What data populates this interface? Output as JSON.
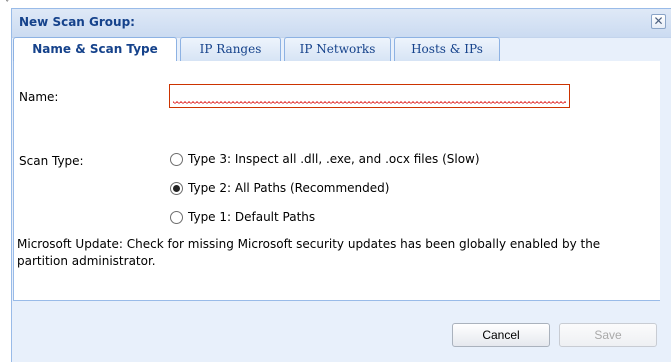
{
  "dialog": {
    "title": "New Scan Group:",
    "close_symbol": "✕",
    "caret_symbol": "ˇ"
  },
  "tabs": [
    {
      "label": "Name & Scan Type",
      "active": true
    },
    {
      "label": "IP Ranges",
      "active": false
    },
    {
      "label": "IP Networks",
      "active": false
    },
    {
      "label": "Hosts & IPs",
      "active": false
    }
  ],
  "form": {
    "name_label": "Name:",
    "name_value": "",
    "name_invalid": true,
    "scan_type_label": "Scan Type:",
    "scan_types": [
      {
        "label": "Type 3: Inspect all .dll, .exe, and .ocx files (Slow)",
        "checked": false
      },
      {
        "label": "Type 2: All Paths (Recommended)",
        "checked": true
      },
      {
        "label": "Type 1: Default Paths",
        "checked": false
      }
    ],
    "note": "Microsoft Update: Check for missing Microsoft security updates has been globally enabled by the partition administrator."
  },
  "buttons": {
    "cancel": "Cancel",
    "save": "Save",
    "save_disabled": true
  },
  "colors": {
    "title_text": "#15428b",
    "invalid_border": "#cc3300",
    "dialog_background": "#e8f0fb"
  }
}
